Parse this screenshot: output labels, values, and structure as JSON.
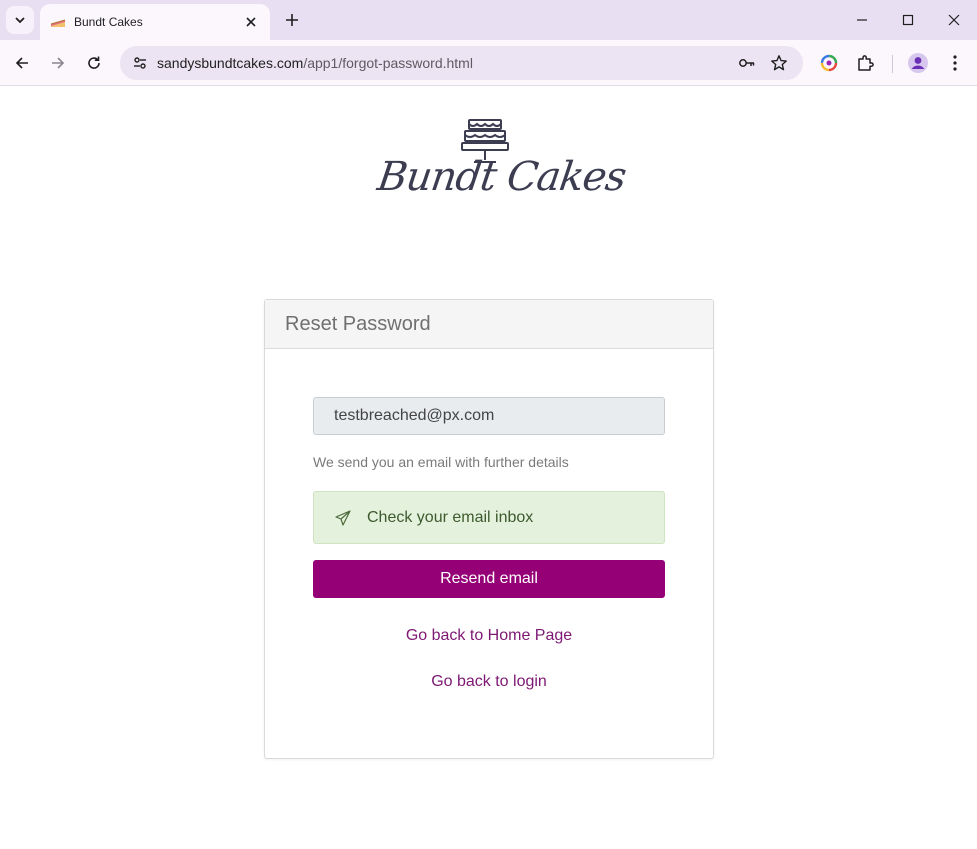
{
  "browser": {
    "tab": {
      "title": "Bundt Cakes",
      "favicon": "cake-slice-icon"
    },
    "url": {
      "host": "sandysbundtcakes.com",
      "path": "/app1/forgot-password.html"
    }
  },
  "page": {
    "logo": {
      "text": "Bundt Cakes",
      "icon": "layered-cake-icon"
    },
    "card": {
      "title": "Reset Password",
      "email_value": "testbreached@px.com",
      "hint": "We send you an email with further details",
      "alert": {
        "text": "Check your email inbox",
        "icon": "paper-plane-icon"
      },
      "resend_label": "Resend email",
      "home_link": "Go back to Home Page",
      "login_link": "Go back to login"
    }
  },
  "colors": {
    "primary": "#950077",
    "link": "#7d1873",
    "alert_bg": "#e4f1dc",
    "chrome_bg": "#e9dff3"
  }
}
